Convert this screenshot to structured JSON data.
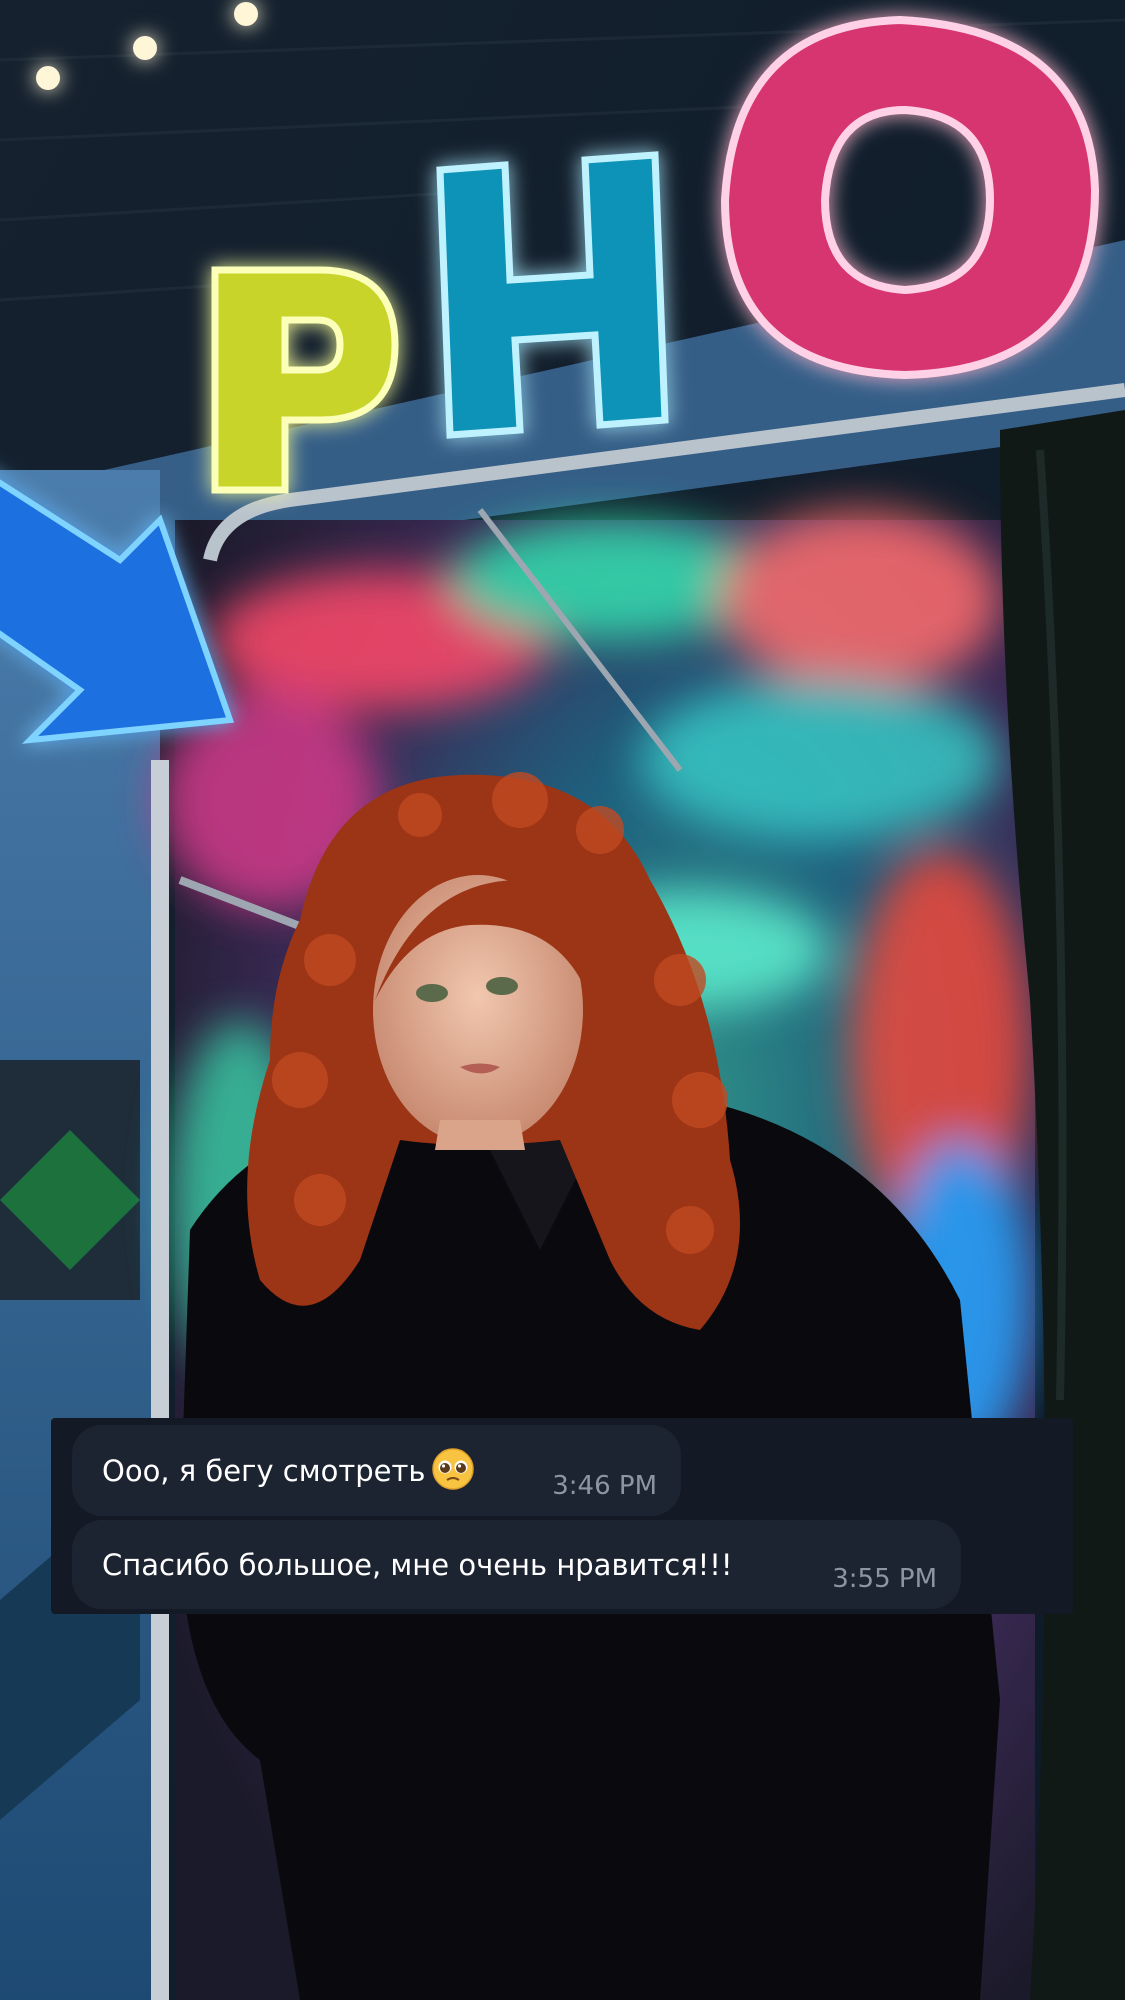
{
  "chat": {
    "messages": [
      {
        "text": "Ооо, я бегу смотреть",
        "emoji": "pleading-face-emoji",
        "time": "3:46 PM"
      },
      {
        "text": "Спасибо большое, мне очень нравится!!!",
        "time": "3:55 PM"
      }
    ]
  },
  "photo": {
    "sign_letters": [
      "P",
      "H",
      "O"
    ],
    "colors": {
      "neon_yellow": "#f3ff5a",
      "neon_cyan": "#35d8ff",
      "neon_pink": "#ff4f98",
      "neon_blue": "#2f8cff",
      "hair": "#a8371a",
      "chat_panel": "#141a25",
      "bubble": "#1d2431"
    }
  }
}
